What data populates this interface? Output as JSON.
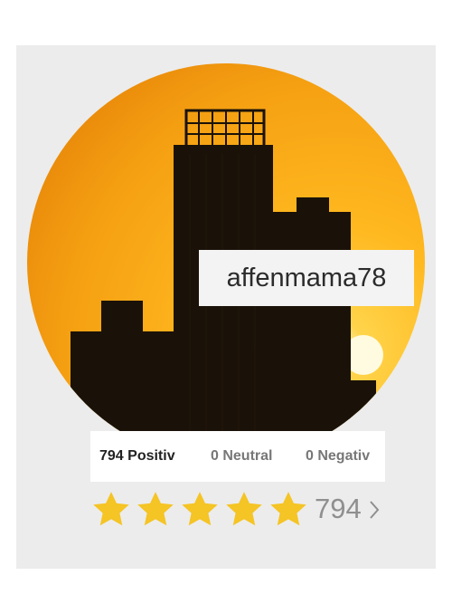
{
  "profile": {
    "username": "affenmama78",
    "avatar_icon": "skyline-sunset-avatar"
  },
  "ratings": {
    "positive_label": "794 Positiv",
    "neutral_label": "0 Neutral",
    "negative_label": "0 Negativ"
  },
  "stars": {
    "rating_value": 5,
    "max": 5,
    "count_label": "794",
    "star_color": "#f5c425",
    "chevron_icon": "chevron-right-icon"
  },
  "colors": {
    "card_bg": "#ececec",
    "sky_top": "#f29a10",
    "sky_mid": "#ffb41d",
    "sky_bottom": "#f7c12e"
  }
}
